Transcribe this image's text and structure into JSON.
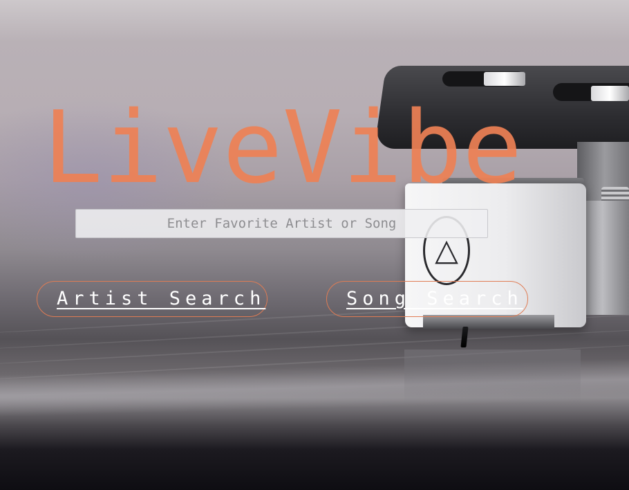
{
  "app": {
    "title": "LiveVibe"
  },
  "search": {
    "placeholder": "Enter Favorite Artist or Song",
    "value": ""
  },
  "actions": {
    "artist_search_label": "Artist Search",
    "song_search_label": "Song Search"
  },
  "colors": {
    "brand": "#ee8155",
    "button_border": "#e07c54",
    "button_text": "#ffffff"
  },
  "background": {
    "subject": "turntable-cartridge-photo"
  }
}
